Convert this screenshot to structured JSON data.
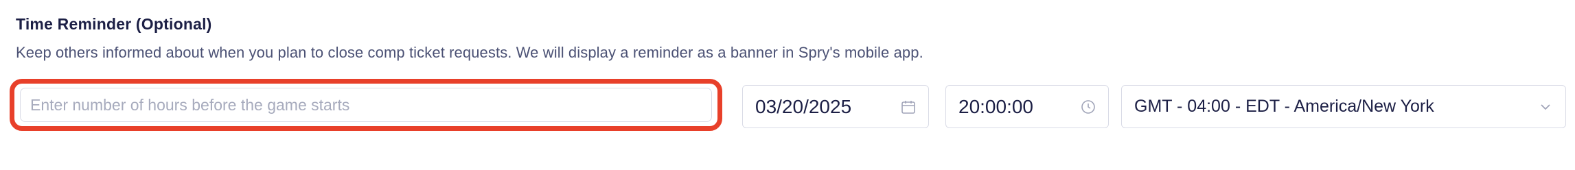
{
  "section": {
    "title": "Time Reminder (Optional)",
    "description": "Keep others informed about when you plan to close comp ticket requests. We will display a reminder as a banner in Spry's mobile app."
  },
  "hours_input": {
    "placeholder": "Enter number of hours before the game starts",
    "value": "",
    "highlight_color": "#e8402a"
  },
  "date_field": {
    "value": "03/20/2025",
    "icon": "calendar-icon"
  },
  "time_field": {
    "value": "20:00:00",
    "icon": "clock-icon"
  },
  "timezone_select": {
    "value": "GMT - 04:00 - EDT - America/New York",
    "icon": "chevron-down-icon"
  },
  "colors": {
    "text_primary": "#1c1f45",
    "text_secondary": "#4c5275",
    "placeholder": "#a7abbd",
    "border": "#d9dbe6",
    "icon": "#a0a4b8"
  }
}
